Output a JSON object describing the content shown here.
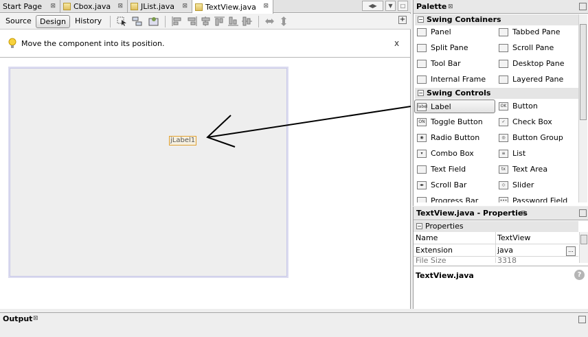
{
  "tabs": [
    {
      "label": "Start Page",
      "close": "⊠",
      "icon": "html-page-icon"
    },
    {
      "label": "Cbox.java",
      "close": "⊠",
      "icon": "java-file-icon"
    },
    {
      "label": "JList.java",
      "close": "⊠",
      "icon": "java-file-icon"
    },
    {
      "label": "TextView.java",
      "close": "⊠",
      "icon": "java-file-icon",
      "active": true
    }
  ],
  "tab_nav": {
    "left": "◀",
    "right": "▶",
    "menu": "▼",
    "restore": "□"
  },
  "toolbar": {
    "source_label": "Source",
    "design_label": "Design",
    "history_label": "History",
    "expand_icon": "+"
  },
  "hint": {
    "text": "Move the component into its position.",
    "close": "x"
  },
  "canvas": {
    "component_label": "jLabel1"
  },
  "palette": {
    "title": "Palette",
    "close": "⊠",
    "categories": [
      {
        "label": "Swing Containers",
        "toggle": "−"
      },
      {
        "label": "Swing Controls",
        "toggle": "−"
      }
    ],
    "containers": [
      {
        "label": "Panel",
        "icon": ""
      },
      {
        "label": "Tabbed Pane",
        "icon": ""
      },
      {
        "label": "Split Pane",
        "icon": ""
      },
      {
        "label": "Scroll Pane",
        "icon": ""
      },
      {
        "label": "Tool Bar",
        "icon": ""
      },
      {
        "label": "Desktop Pane",
        "icon": ""
      },
      {
        "label": "Internal Frame",
        "icon": ""
      },
      {
        "label": "Layered Pane",
        "icon": ""
      }
    ],
    "controls": [
      {
        "label": "Label",
        "icon": "label"
      },
      {
        "label": "Button",
        "icon": "OK"
      },
      {
        "label": "Toggle Button",
        "icon": "ON"
      },
      {
        "label": "Check Box",
        "icon": "✓"
      },
      {
        "label": "Radio Button",
        "icon": "◉"
      },
      {
        "label": "Button Group",
        "icon": "◎"
      },
      {
        "label": "Combo Box",
        "icon": "▾"
      },
      {
        "label": "List",
        "icon": "≡"
      },
      {
        "label": "Text Field",
        "icon": ""
      },
      {
        "label": "Text Area",
        "icon": "tx"
      },
      {
        "label": "Scroll Bar",
        "icon": "◂▸"
      },
      {
        "label": "Slider",
        "icon": "◇"
      },
      {
        "label": "Progress Bar",
        "icon": ""
      },
      {
        "label": "Password Field",
        "icon": "•••"
      }
    ]
  },
  "properties": {
    "title": "TextView.java - Properties",
    "close": "⊠",
    "section": "Properties",
    "section_toggle": "−",
    "rows": [
      {
        "key": "Name",
        "value": "TextView"
      },
      {
        "key": "Extension",
        "value": "java"
      },
      {
        "key": "File Size",
        "value": "3318"
      }
    ],
    "edit_button": "...",
    "description": "TextView.java",
    "help": "?"
  },
  "output": {
    "title": "Output",
    "close": "⊠"
  },
  "colors": {
    "selection_border": "#e0a030",
    "canvas_border": "#dcdcf0"
  }
}
